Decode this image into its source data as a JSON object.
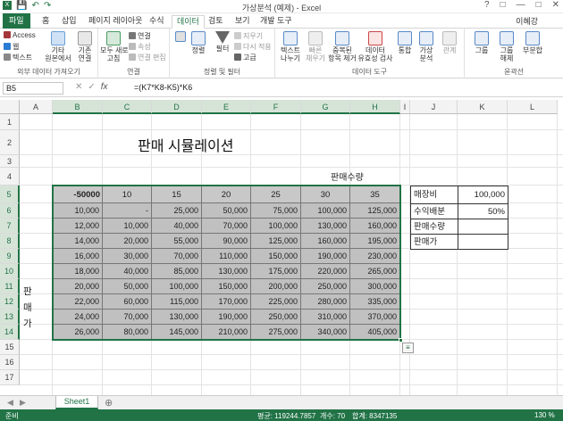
{
  "window": {
    "title": "가상분석 (예제) - Excel",
    "user": "이혜강"
  },
  "tabs": [
    {
      "label": "파일"
    },
    {
      "label": "홈"
    },
    {
      "label": "삽입"
    },
    {
      "label": "페이지 레이아웃"
    },
    {
      "label": "수식"
    },
    {
      "label": "데이터"
    },
    {
      "label": "검토"
    },
    {
      "label": "보기"
    },
    {
      "label": "개발 도구"
    }
  ],
  "ribbon": {
    "groups": [
      {
        "label": "외부 데이터 가져오기"
      },
      {
        "label": "연결"
      },
      {
        "label": "정렬 및 필터"
      },
      {
        "label": "데이터 도구"
      },
      {
        "label": "윤곽선"
      }
    ],
    "buttons": {
      "access": "Access",
      "web": "웹",
      "text": "텍스트",
      "other": "기타\n원본에서",
      "existing": "기존\n연결",
      "refresh": "모두 새로\n고침",
      "connections": "연결",
      "properties": "속성",
      "edit_links": "연결 편집",
      "sort": "정렬",
      "filter": "필터",
      "clear": "지우기",
      "reapply": "다시 적용",
      "advanced": "고급",
      "text_to_columns": "텍스트\n나누기",
      "flash_fill": "빠른\n채우기",
      "remove_dup": "중복된\n항목 제거",
      "validation": "데이터\n유효성 검사",
      "consolidate": "통합",
      "what_if": "가상\n분석",
      "relationships": "관계",
      "group": "그룹",
      "ungroup": "그룹\n해제",
      "subtotal": "부분합"
    }
  },
  "formula_bar": {
    "name_box": "B5",
    "formula": "=(K7*K8-K5)*K6",
    "fx": "fx"
  },
  "columns": [
    "A",
    "B",
    "C",
    "D",
    "E",
    "F",
    "G",
    "H",
    "I",
    "J",
    "K",
    "L"
  ],
  "rows": [
    "1",
    "2",
    "3",
    "4",
    "5",
    "6",
    "7",
    "8",
    "9",
    "10",
    "11",
    "12",
    "13",
    "14",
    "15",
    "16",
    "17"
  ],
  "sheet": {
    "title": "판매 시뮬레이션",
    "x_label": "판매수량",
    "y_label": [
      "판",
      "매",
      "가"
    ],
    "corner": "-50000",
    "header_row": [
      "10",
      "15",
      "20",
      "25",
      "30",
      "35"
    ],
    "table": [
      [
        "10,000",
        "-",
        "25,000",
        "50,000",
        "75,000",
        "100,000",
        "125,000"
      ],
      [
        "12,000",
        "10,000",
        "40,000",
        "70,000",
        "100,000",
        "130,000",
        "160,000"
      ],
      [
        "14,000",
        "20,000",
        "55,000",
        "90,000",
        "125,000",
        "160,000",
        "195,000"
      ],
      [
        "16,000",
        "30,000",
        "70,000",
        "110,000",
        "150,000",
        "190,000",
        "230,000"
      ],
      [
        "18,000",
        "40,000",
        "85,000",
        "130,000",
        "175,000",
        "220,000",
        "265,000"
      ],
      [
        "20,000",
        "50,000",
        "100,000",
        "150,000",
        "200,000",
        "250,000",
        "300,000"
      ],
      [
        "22,000",
        "60,000",
        "115,000",
        "170,000",
        "225,000",
        "280,000",
        "335,000"
      ],
      [
        "24,000",
        "70,000",
        "130,000",
        "190,000",
        "250,000",
        "310,000",
        "370,000"
      ],
      [
        "26,000",
        "80,000",
        "145,000",
        "210,000",
        "275,000",
        "340,000",
        "405,000"
      ]
    ],
    "side_table": [
      {
        "label": "매장비",
        "value": "100,000"
      },
      {
        "label": "수익배분",
        "value": "50%"
      },
      {
        "label": "판매수량",
        "value": ""
      },
      {
        "label": "판매가",
        "value": ""
      }
    ]
  },
  "sheet_tab": "Sheet1",
  "status": {
    "ready": "준비",
    "average": "평균: 119244.7857",
    "count": "개수: 70",
    "sum": "합계: 8347135",
    "zoom": "130 %"
  }
}
